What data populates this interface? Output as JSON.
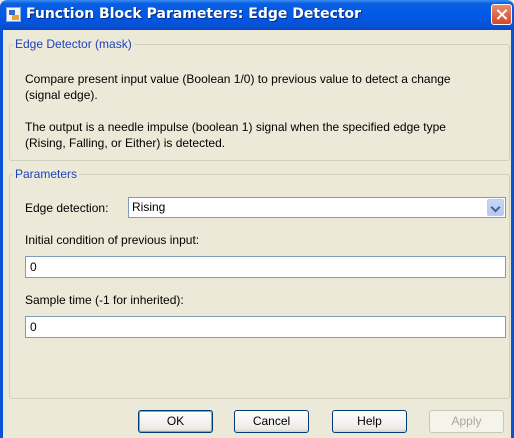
{
  "window": {
    "title": "Function Block Parameters: Edge Detector"
  },
  "mask_group": {
    "legend": "Edge Detector (mask)",
    "desc1_line1": "Compare present input value (Boolean 1/0) to previous value to detect a change",
    "desc1_line2": "(signal edge).",
    "desc2_line1": "The output is a needle impulse (boolean 1) signal when  the specified edge type",
    "desc2_line2": "(Rising, Falling, or Either) is detected."
  },
  "parameters": {
    "legend": "Parameters",
    "edge_label": "Edge detection:",
    "edge_value": "Rising",
    "ic_label": "Initial condition of previous input:",
    "ic_value": "0",
    "sample_label": "Sample time (-1 for inherited):",
    "sample_value": "0"
  },
  "buttons": {
    "ok": "OK",
    "cancel": "Cancel",
    "help": "Help",
    "apply": "Apply"
  }
}
